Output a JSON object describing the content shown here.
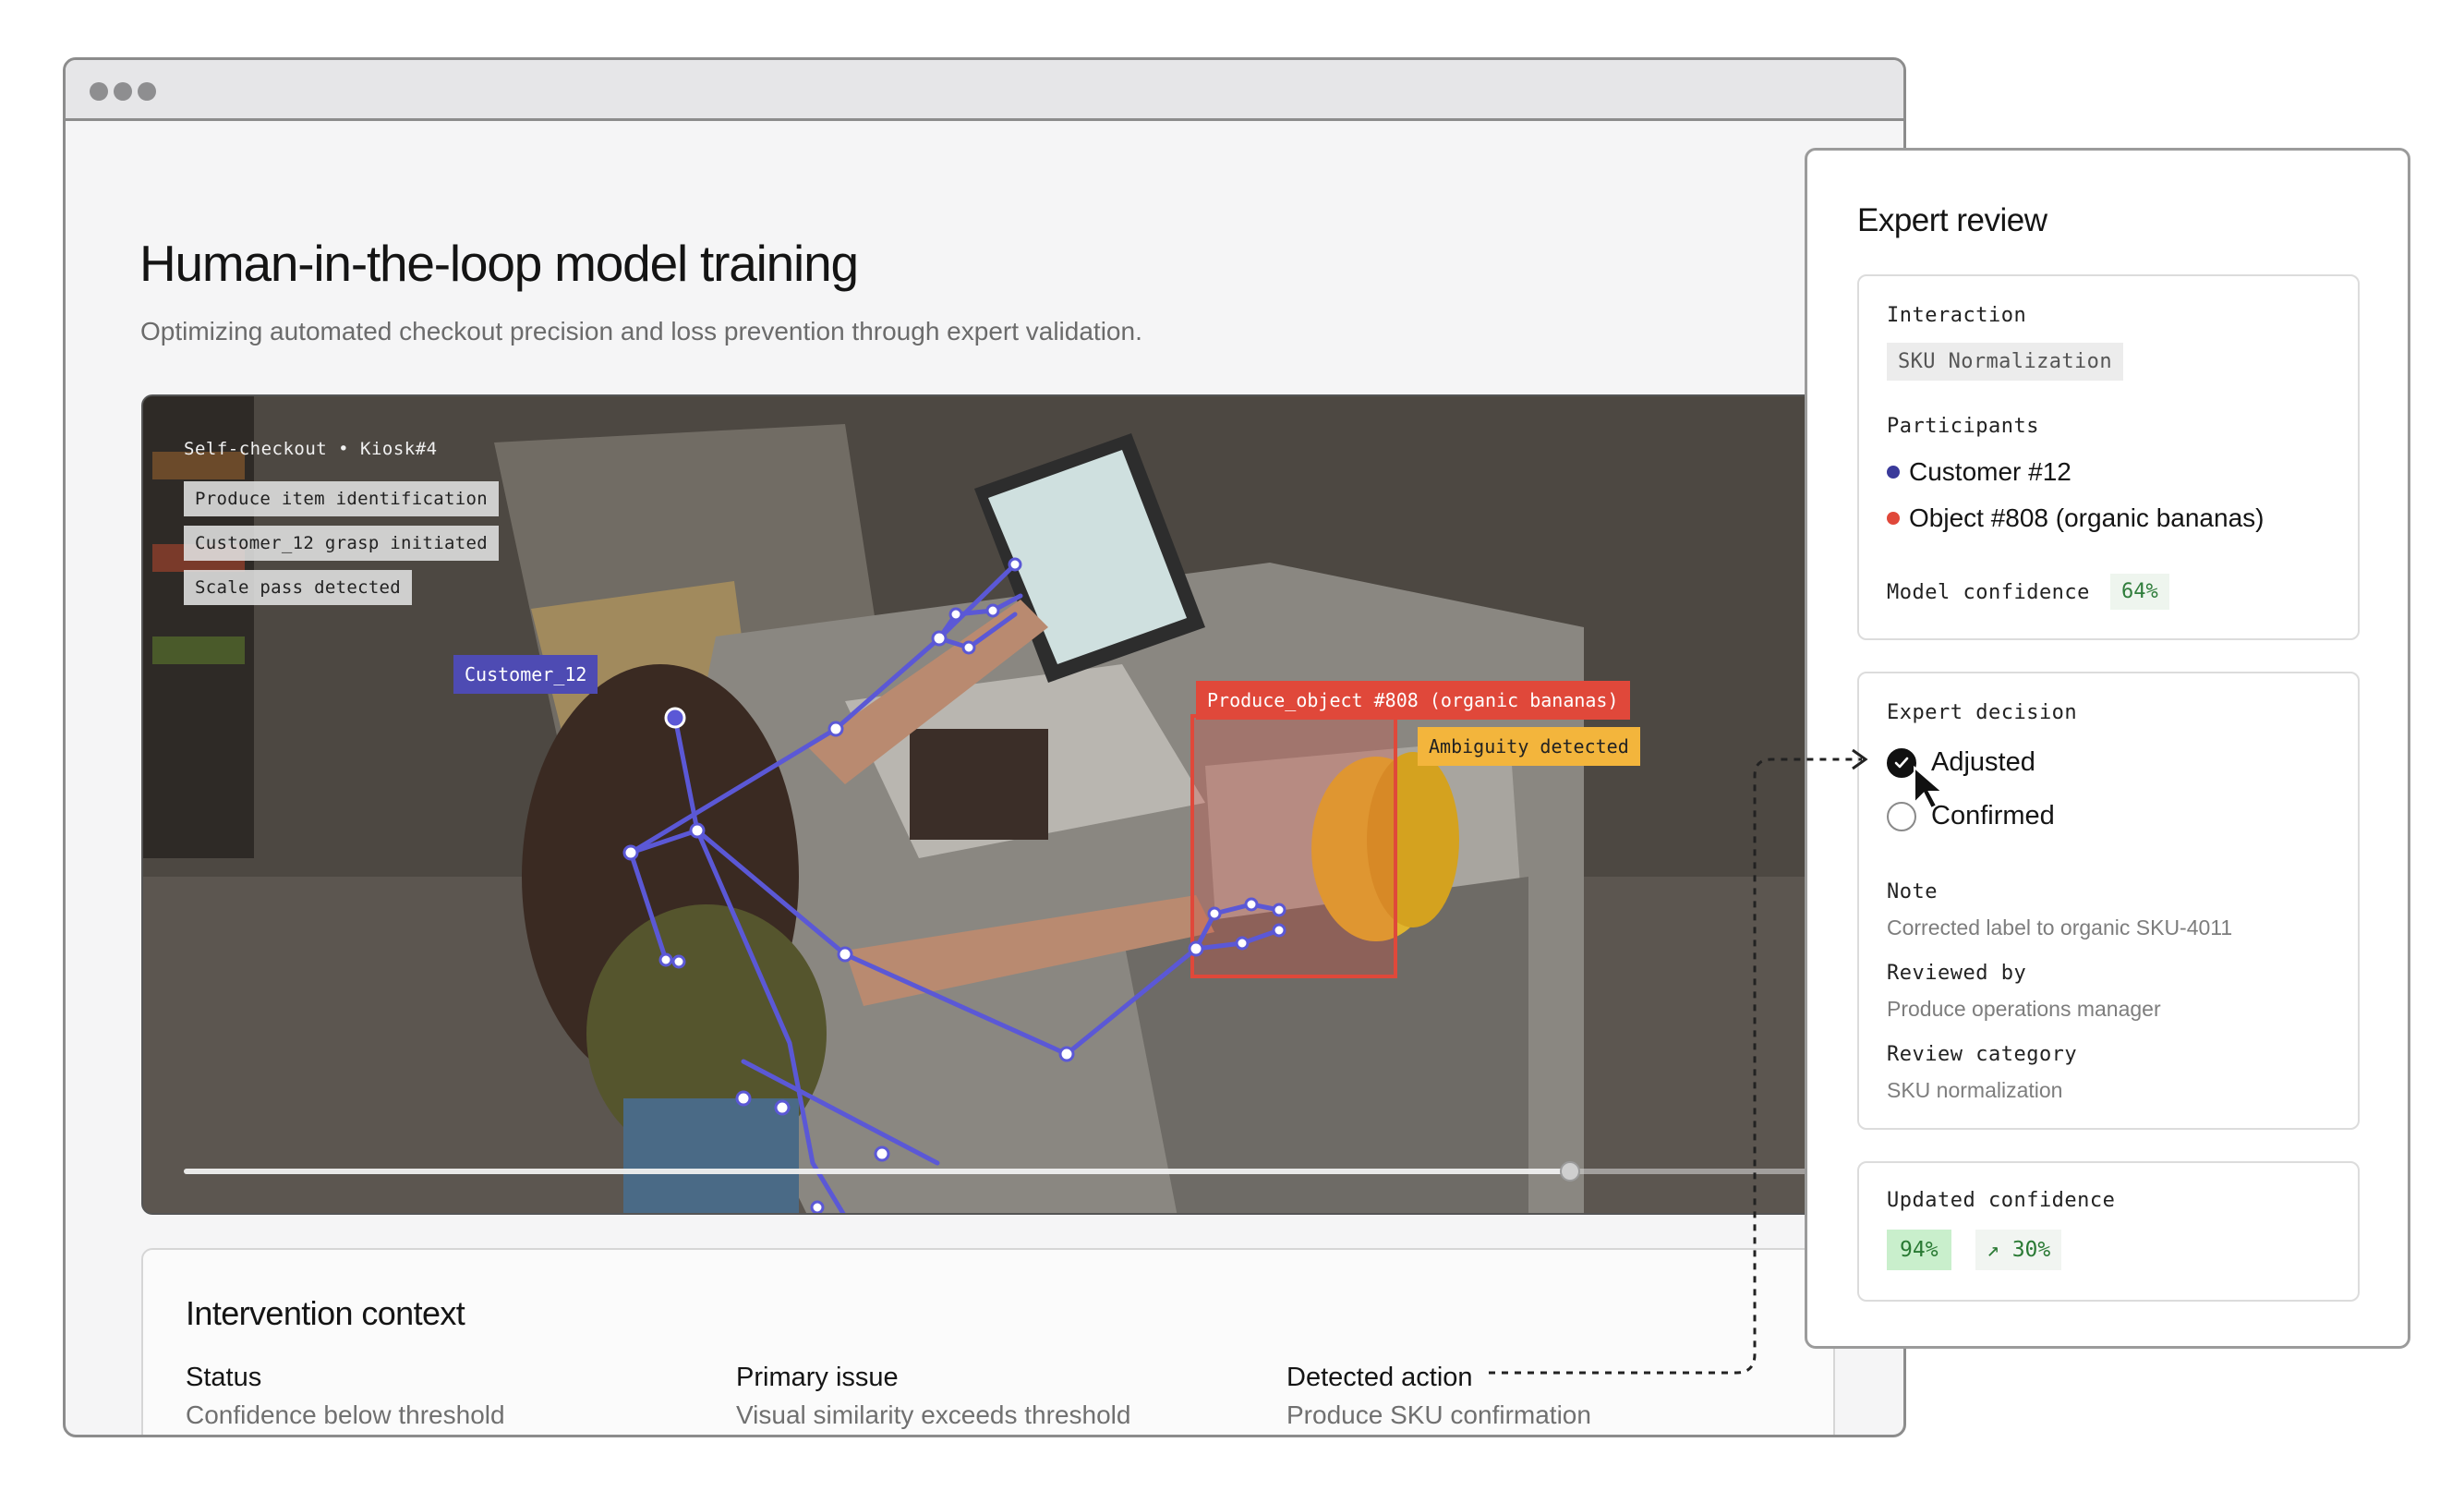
{
  "page": {
    "title": "Human-in-the-loop model training",
    "subtitle": "Optimizing automated checkout precision and loss prevention through expert validation."
  },
  "video": {
    "camera_label": "Self-checkout • Kiosk#4",
    "tags": [
      "Produce item identification",
      "Customer_12 grasp initiated",
      "Scale pass detected"
    ],
    "customer_label": "Customer_12",
    "produce_label": "Produce_object #808 (organic bananas)",
    "ambiguity_label": "Ambiguity detected",
    "playback_progress": 0.79,
    "colors": {
      "customer": "#4e4bb3",
      "produce": "#e0483a",
      "ambiguity": "#f3b53c"
    }
  },
  "context": {
    "title": "Intervention context",
    "columns": [
      {
        "label": "Status",
        "value": "Confidence below threshold"
      },
      {
        "label": "Primary issue",
        "value": "Visual similarity exceeds threshold"
      },
      {
        "label": "Detected action",
        "value": "Produce SKU confirmation"
      }
    ]
  },
  "review": {
    "title": "Expert review",
    "interaction_label": "Interaction",
    "interaction_value": "SKU Normalization",
    "participants_label": "Participants",
    "participants": [
      {
        "name": "Customer #12",
        "color": "#3a3a9a"
      },
      {
        "name": "Object #808 (organic bananas)",
        "color": "#e0483a"
      }
    ],
    "model_confidence_label": "Model confidence",
    "model_confidence_value": "64%",
    "decision_label": "Expert decision",
    "options": [
      {
        "label": "Adjusted",
        "checked": true
      },
      {
        "label": "Confirmed",
        "checked": false
      }
    ],
    "note_label": "Note",
    "note_value": "Corrected label to organic SKU-4011",
    "reviewed_by_label": "Reviewed by",
    "reviewed_by_value": "Produce operations manager",
    "category_label": "Review category",
    "category_value": "SKU normalization",
    "updated_confidence_label": "Updated confidence",
    "updated_confidence_value": "94%",
    "updated_confidence_delta": "↗ 30%"
  }
}
